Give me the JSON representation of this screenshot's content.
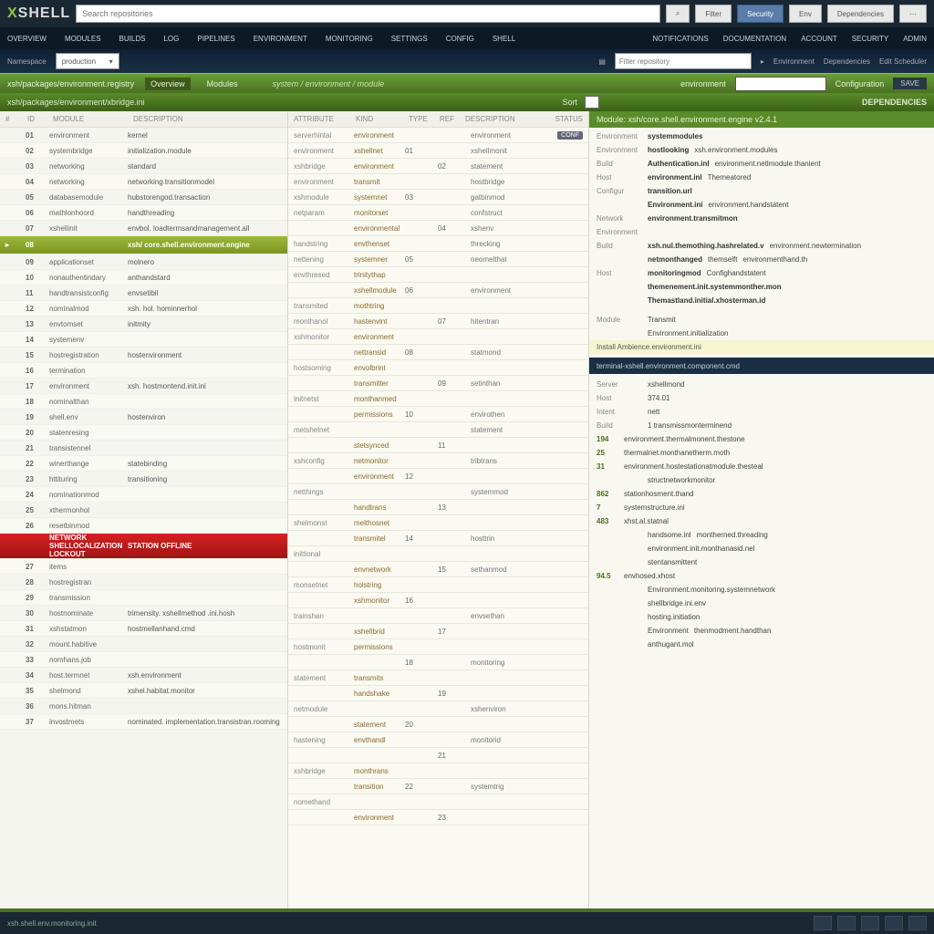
{
  "brand": {
    "x": "X",
    "sh": "SHELL"
  },
  "search": {
    "placeholder": "Search repositories"
  },
  "topbtns": [
    {
      "l": "Filter"
    },
    {
      "l": "Security",
      "cls": "blue"
    },
    {
      "l": "Env"
    },
    {
      "l": "Dependencies"
    }
  ],
  "nav": [
    "Overview",
    "Modules",
    "Builds",
    "Log",
    "Pipelines",
    "Environment",
    "Monitoring",
    "Settings",
    "Config",
    "Shell"
  ],
  "nav_r": [
    "Notifications",
    "Documentation",
    "Account",
    "Security",
    "Admin"
  ],
  "subbar": {
    "lbl": "Namespace",
    "dd": "production",
    "r_lbl": "Filter repository",
    "r_links": [
      "Environment",
      "Dependencies",
      "Edit Scheduler"
    ]
  },
  "greenbar": {
    "breadcrumb": "xsh/packages/environment.registry",
    "tabs": [
      "Overview",
      "Modules"
    ],
    "mid": "system / environment / module",
    "r": [
      "environment",
      "Configuration"
    ],
    "btn": "SAVE"
  },
  "titlebar": {
    "l": "xsh/packages/environment/xbridge.ini",
    "r_lbl": "Sort",
    "r_title": "DEPENDENCIES"
  },
  "left_hdr": [
    "#",
    "ID",
    "Module",
    "Description"
  ],
  "left_rows": [
    {
      "i": "",
      "id": "01",
      "m": "environment",
      "d": "kernel"
    },
    {
      "i": "",
      "id": "02",
      "m": "systembridge",
      "d": "initialization.module"
    },
    {
      "i": "",
      "id": "03",
      "m": "networking",
      "d": "standard"
    },
    {
      "i": "",
      "id": "04",
      "m": "networking",
      "d": "networking.transitionmodel"
    },
    {
      "i": "",
      "id": "05",
      "m": "databasemodule",
      "d": "hubstorengod.transaction"
    },
    {
      "i": "",
      "id": "06",
      "m": "mathlonhoord",
      "d": "handthreading"
    },
    {
      "i": "",
      "id": "07",
      "m": "xshellinit",
      "d": "envbol. loadtermsandmanagement.all"
    },
    {
      "sel": true,
      "i": "▸",
      "id": "08",
      "m": "",
      "d": "xsh/ core.shell.environment.engine"
    },
    {
      "i": "",
      "id": "09",
      "m": "applicationset",
      "d": "molnero"
    },
    {
      "i": "",
      "id": "10",
      "m": "nonauthentindary",
      "d": "anthandstard"
    },
    {
      "i": "",
      "id": "11",
      "m": "handtransistconfig",
      "d": "envsetibil"
    },
    {
      "i": "",
      "id": "12",
      "m": "nominalmod",
      "d": "xsh. hol. hominnerhol"
    },
    {
      "i": "",
      "id": "13",
      "m": "envtomset",
      "d": "initmity"
    },
    {
      "i": "",
      "id": "14",
      "m": "systemenv",
      "d": ""
    },
    {
      "i": "",
      "id": "15",
      "m": "hostregistration",
      "d": "hostenvironment"
    },
    {
      "i": "",
      "id": "16",
      "m": "termination",
      "d": ""
    },
    {
      "i": "",
      "id": "17",
      "m": "environment",
      "d": "xsh. hostmontend.init.ini"
    },
    {
      "i": "",
      "id": "18",
      "m": "nominalthan",
      "d": ""
    },
    {
      "i": "",
      "id": "19",
      "m": "shell.env",
      "d": "hostenviron"
    },
    {
      "i": "",
      "id": "20",
      "m": "statenresing",
      "d": ""
    },
    {
      "i": "",
      "id": "21",
      "m": "transistennel",
      "d": ""
    },
    {
      "i": "",
      "id": "22",
      "m": "winerthange",
      "d": "statebinding"
    },
    {
      "i": "",
      "id": "23",
      "m": "httituring",
      "d": "transitioning"
    },
    {
      "i": "",
      "id": "24",
      "m": "nominationmod",
      "d": ""
    },
    {
      "i": "",
      "id": "25",
      "m": "xthermonhol",
      "d": ""
    },
    {
      "i": "",
      "id": "26",
      "m": "resetbinmod",
      "d": ""
    },
    {
      "alert": true,
      "i": "",
      "id": "",
      "m": "NETWORK SHELLOCALIZATION LOCKOUT",
      "d": "STATION OFFLINE"
    },
    {
      "i": "",
      "id": "27",
      "m": "items",
      "d": ""
    },
    {
      "i": "",
      "id": "28",
      "m": "hostregistran",
      "d": ""
    },
    {
      "i": "",
      "id": "29",
      "m": "transmission",
      "d": ""
    },
    {
      "i": "",
      "id": "30",
      "m": "hostnominate",
      "d": "trimensity. xshellmethod .ini.hosh"
    },
    {
      "i": "",
      "id": "31",
      "m": "xshstatmon",
      "d": "hostmellanhand.cmd"
    },
    {
      "i": "",
      "id": "32",
      "m": "mount.habitive",
      "d": ""
    },
    {
      "i": "",
      "id": "33",
      "m": "nomhans.job",
      "d": ""
    },
    {
      "i": "",
      "id": "34",
      "m": "host.termnet",
      "d": "xsh.environment"
    },
    {
      "i": "",
      "id": "35",
      "m": "shelmond",
      "d": "xshel.habitat.monitor"
    },
    {
      "i": "",
      "id": "36",
      "m": "mons.hitman",
      "d": ""
    },
    {
      "i": "",
      "id": "37",
      "m": "invostmets",
      "d": "nominated. implementation.transistran.rooming"
    }
  ],
  "mid_hdr": [
    "Attribute",
    "Kind",
    "Type",
    "Ref",
    "Description",
    "Status"
  ],
  "mid_rows": [
    {
      "a": "serverhintal",
      "k": "environment",
      "t": "",
      "r": "",
      "d": "environment",
      "s": "CONF"
    },
    {
      "a": "environment",
      "k": "xshellnet",
      "t": "01",
      "r": "",
      "d": "xshellmonit",
      "s": ""
    },
    {
      "a": "xshbridge",
      "k": "environment",
      "t": "",
      "r": "02",
      "d": "statement",
      "s": ""
    },
    {
      "a": "environment",
      "k": "transmit",
      "t": "",
      "r": "",
      "d": "hostbridge",
      "s": ""
    },
    {
      "a": "xshmodule",
      "k": "systemnet",
      "t": "03",
      "r": "",
      "d": "gatbinmod",
      "s": ""
    },
    {
      "a": "netparam",
      "k": "monitorset",
      "t": "",
      "r": "",
      "d": "confstruct",
      "s": ""
    },
    {
      "a": "",
      "k": "environmental",
      "t": "",
      "r": "04",
      "d": "xshenv",
      "s": ""
    },
    {
      "a": "handstring",
      "k": "envthenset",
      "t": "",
      "r": "",
      "d": "threcking",
      "s": ""
    },
    {
      "a": "nettening",
      "k": "systemner",
      "t": "05",
      "r": "",
      "d": "neomelthat",
      "s": ""
    },
    {
      "a": "envthresed",
      "k": "trinitythap",
      "t": "",
      "r": "",
      "d": "",
      "s": ""
    },
    {
      "a": "",
      "k": "xshellmodule",
      "t": "06",
      "r": "",
      "d": "environment",
      "s": ""
    },
    {
      "a": "transmited",
      "k": "mothtring",
      "t": "",
      "r": "",
      "d": "",
      "s": ""
    },
    {
      "a": "monthanol",
      "k": "hastenvint",
      "t": "",
      "r": "07",
      "d": "hitentran",
      "s": ""
    },
    {
      "a": "xshmonitor",
      "k": "environment",
      "t": "",
      "r": "",
      "d": "",
      "s": ""
    },
    {
      "a": "",
      "k": "nettransid",
      "t": "08",
      "r": "",
      "d": "statmond",
      "s": ""
    },
    {
      "a": "hostsoming",
      "k": "envolbrint",
      "t": "",
      "r": "",
      "d": "",
      "s": ""
    },
    {
      "a": "",
      "k": "transmitter",
      "t": "",
      "r": "09",
      "d": "setinthan",
      "s": ""
    },
    {
      "a": "initnetst",
      "k": "monthanmed",
      "t": "",
      "r": "",
      "d": "",
      "s": ""
    },
    {
      "a": "",
      "k": "permissions",
      "t": "10",
      "r": "",
      "d": "envirothen",
      "s": ""
    },
    {
      "a": "metshelnet",
      "k": "",
      "t": "",
      "r": "",
      "d": "statement",
      "s": ""
    },
    {
      "a": "",
      "k": "stetsynced",
      "t": "",
      "r": "11",
      "d": "",
      "s": ""
    },
    {
      "a": "xshconfig",
      "k": "netmonitor",
      "t": "",
      "r": "",
      "d": "tribtrans",
      "s": ""
    },
    {
      "a": "",
      "k": "environment",
      "t": "12",
      "r": "",
      "d": "",
      "s": ""
    },
    {
      "a": "netthings",
      "k": "",
      "t": "",
      "r": "",
      "d": "systemmod",
      "s": ""
    },
    {
      "a": "",
      "k": "handtrans",
      "t": "",
      "r": "13",
      "d": "",
      "s": ""
    },
    {
      "a": "shelmonst",
      "k": "melthosnet",
      "t": "",
      "r": "",
      "d": "",
      "s": ""
    },
    {
      "a": "",
      "k": "transmitel",
      "t": "14",
      "r": "",
      "d": "hosttrin",
      "s": ""
    },
    {
      "a": "inittional",
      "k": "",
      "t": "",
      "r": "",
      "d": "",
      "s": ""
    },
    {
      "a": "",
      "k": "envnetwork",
      "t": "",
      "r": "15",
      "d": "sethanmod",
      "s": ""
    },
    {
      "a": "monsetnet",
      "k": "holstring",
      "t": "",
      "r": "",
      "d": "",
      "s": ""
    },
    {
      "a": "",
      "k": "xshmonitor",
      "t": "16",
      "r": "",
      "d": "",
      "s": ""
    },
    {
      "a": "trainshan",
      "k": "",
      "t": "",
      "r": "",
      "d": "envsethan",
      "s": ""
    },
    {
      "a": "",
      "k": "xshellbrid",
      "t": "",
      "r": "17",
      "d": "",
      "s": ""
    },
    {
      "a": "hostmonit",
      "k": "permissions",
      "t": "",
      "r": "",
      "d": "",
      "s": ""
    },
    {
      "a": "",
      "k": "",
      "t": "18",
      "r": "",
      "d": "monitoring",
      "s": ""
    },
    {
      "a": "statement",
      "k": "transmits",
      "t": "",
      "r": "",
      "d": "",
      "s": ""
    },
    {
      "a": "",
      "k": "handshake",
      "t": "",
      "r": "19",
      "d": "",
      "s": ""
    },
    {
      "a": "netmodule",
      "k": "",
      "t": "",
      "r": "",
      "d": "xshenviron",
      "s": ""
    },
    {
      "a": "",
      "k": "statement",
      "t": "20",
      "r": "",
      "d": "",
      "s": ""
    },
    {
      "a": "hastening",
      "k": "envthandl",
      "t": "",
      "r": "",
      "d": "monitorid",
      "s": ""
    },
    {
      "a": "",
      "k": "",
      "t": "",
      "r": "21",
      "d": "",
      "s": ""
    },
    {
      "a": "xshbridge",
      "k": "monthrans",
      "t": "",
      "r": "",
      "d": "",
      "s": ""
    },
    {
      "a": "",
      "k": "transition",
      "t": "22",
      "r": "",
      "d": "systemtrig",
      "s": ""
    },
    {
      "a": "nomethand",
      "k": "",
      "t": "",
      "r": "",
      "d": "",
      "s": ""
    },
    {
      "a": "",
      "k": "environment",
      "t": "",
      "r": "23",
      "d": "",
      "s": ""
    }
  ],
  "right": {
    "hdr": "Module: xsh/core.shell.environment.engine v2.4.1",
    "meta": [
      {
        "k": "Environment",
        "v": "systemmodules"
      },
      {
        "k": "Environment",
        "v": "hostlooking",
        "v2": "xsh.environment.modules"
      },
      {
        "k": "Build",
        "v": "Authentication.inl",
        "v2": "environment.netlmodule.thanient"
      },
      {
        "k": "Host",
        "v": "environment.inl",
        "v2": "Themeatored"
      },
      {
        "k": "Configur",
        "v": "transition.url"
      },
      {
        "k": "",
        "v": "Environment.ini",
        "v2": "environment.handstatent"
      },
      {
        "k": "Network",
        "v": "environment.transmitmon"
      }
    ],
    "sep1": "Environment",
    "kv": [
      {
        "k": "Build",
        "v": "xsh.nul.themothing.hashrelated.v",
        "v2": "environment.newtermination"
      },
      {
        "k": "",
        "v": "netmonthanged",
        "v2": "themselft",
        "v3": "environmenthand.th"
      },
      {
        "k": "Host",
        "v": "monitoringmod",
        "v2": "Confighandstatent"
      },
      {
        "k": "",
        "v": "themenement.init.systemmonther.mon"
      },
      {
        "k": "",
        "v": "Themastland.initial.xhosterman.id"
      }
    ],
    "kv2": [
      {
        "k": "Module",
        "v": "Transmit"
      },
      {
        "k": "",
        "v": "Environment.initialization"
      }
    ],
    "sep2": "Install Ambience.environment.ini",
    "bar": "terminal-xshell.environment.component.cmd",
    "rows2": [
      {
        "k": "Server",
        "v": "xshellmond"
      },
      {
        "k": "Host",
        "v": "374.01"
      },
      {
        "k": "Intent",
        "v": "nett"
      },
      {
        "k": "Build",
        "v": "1  transmissmonterminend"
      },
      {
        "n": "194",
        "v": "environment.thermalmonent.thestone"
      },
      {
        "n": "25",
        "v": "thermalnet.monthanetherm.moth"
      },
      {
        "n": "31",
        "v": "environment.hostestationatmodule.thesteal"
      },
      {
        "k": "",
        "v": "structnetworkmonitor"
      },
      {
        "n": "862",
        "v": "stationhosment.thand"
      },
      {
        "n": "7",
        "v": "systemstructure.ini",
        "g": true
      },
      {
        "n": "483",
        "v": "xhst.al.statnal"
      },
      {
        "k": "",
        "v": "handsome.inl",
        "v2": "montherned.threading"
      },
      {
        "k": "",
        "v": "environment.init.monthanasid.nel"
      },
      {
        "k": "",
        "v": "stentansmittent"
      },
      {
        "n": "94.5",
        "v": "envhosed.xhost"
      },
      {
        "k": "",
        "v": "Environment.monitoring.systemnetwork"
      },
      {
        "k": "",
        "v": "shellbridge.ini.env"
      },
      {
        "k": "",
        "v": "hosting.initiation"
      },
      {
        "k": "",
        "v": "Environment",
        "v2": "thenmodment.handthan"
      },
      {
        "k": "",
        "v": "anthugant.mol"
      }
    ]
  },
  "footer": {
    "stat": "xsh.shell.env.monitoring.init"
  }
}
